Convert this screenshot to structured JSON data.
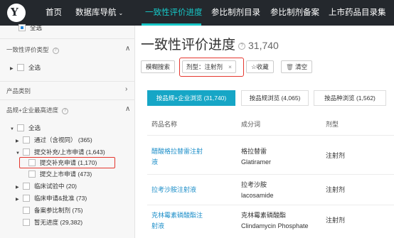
{
  "nav": {
    "items": [
      {
        "label": "首页"
      },
      {
        "label": "数据库导航",
        "chevron": "⌄"
      },
      {
        "label": "一致性评价进度"
      },
      {
        "label": "参比制剂目录"
      },
      {
        "label": "参比制剂备案"
      },
      {
        "label": "上市药品目录集"
      }
    ]
  },
  "sidebar": {
    "top_select_all": "全选",
    "section1": {
      "title": "一致性评价类型",
      "select_all": "全选"
    },
    "section2": {
      "title": "产品类别"
    },
    "section3": {
      "title": "品规+企业最高进度",
      "tree": [
        {
          "label": "全选"
        },
        {
          "label": "通过（含视同）",
          "count": "(365)"
        },
        {
          "label": "提交补充/上市申请",
          "count": "(1,643)"
        },
        {
          "label": "提交补充申请",
          "count": "(1,170)"
        },
        {
          "label": "提交上市申请",
          "count": "(473)"
        },
        {
          "label": "临床试验中",
          "count": "(20)"
        },
        {
          "label": "临床申请&批准",
          "count": "(73)"
        },
        {
          "label": "备案参比制剂",
          "count": "(75)"
        },
        {
          "label": "暂无进度",
          "count": "(29,382)"
        }
      ]
    }
  },
  "main": {
    "title": "一致性评价进度",
    "count": "31,740",
    "fuzzy_search": "模糊搜索",
    "filter_tag": {
      "label": "剂型：注射剂",
      "remove": "×"
    },
    "favorite": "☆收藏",
    "clear": "清空",
    "tabs": [
      {
        "label": "按品规+企业浏览 (31,740)"
      },
      {
        "label": "按品规浏览 (4,065)"
      },
      {
        "label": "按品种浏览 (1,562)"
      }
    ],
    "table": {
      "headers": [
        "药品名称",
        "成分词",
        "剂型"
      ],
      "rows": [
        {
          "name_line1": "醋酸格拉替雷注射",
          "name_line2": "液",
          "ingredient_cn": "格拉替雷",
          "ingredient_en": "Glatiramer",
          "form": "注射剂"
        },
        {
          "name_line1": "拉考沙胺注射液",
          "name_line2": "",
          "ingredient_cn": "拉考沙胺",
          "ingredient_en": "lacosamide",
          "form": "注射剂"
        },
        {
          "name_line1": "克林霉素磷酸酯注",
          "name_line2": "射液",
          "ingredient_cn": "克林霉素磷酸酯",
          "ingredient_en": "Clindamycin Phosphate",
          "form": "注射剂"
        }
      ]
    }
  },
  "colors": {
    "accent": "#16c5c5",
    "tab_active": "#16a6c6",
    "highlight": "#e5362e",
    "link": "#1e8fc9"
  },
  "icons": [
    "logo-icon",
    "chevron-down-icon",
    "help-icon",
    "close-icon",
    "trash-icon",
    "star-icon",
    "caret-right-icon",
    "caret-down-icon"
  ]
}
